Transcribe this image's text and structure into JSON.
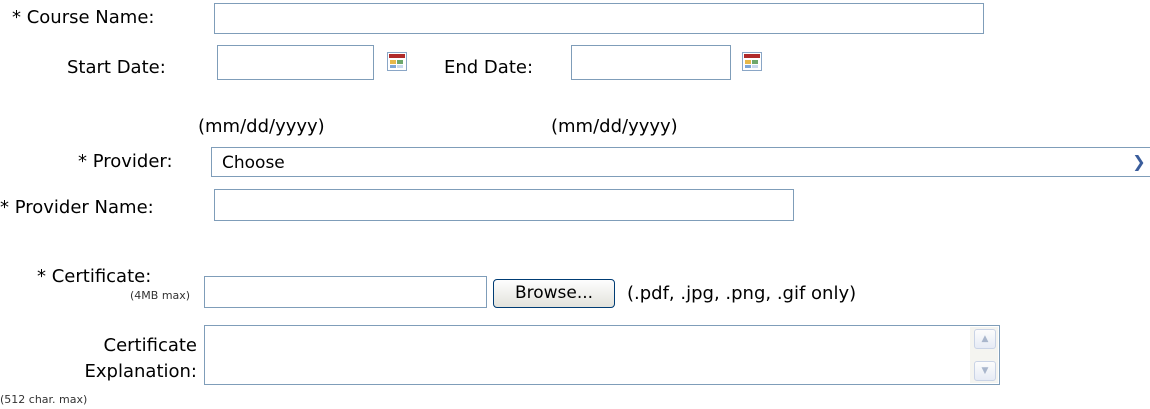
{
  "form": {
    "course_name_label": "* Course Name:",
    "course_name_value": "",
    "start_date_label": "Start Date:",
    "start_date_value": "",
    "end_date_label": "End Date:",
    "end_date_value": "",
    "date_format_hint_start": "(mm/dd/yyyy)",
    "date_format_hint_end": "(mm/dd/yyyy)",
    "provider_label": "* Provider:",
    "provider_selected": "Choose",
    "provider_name_label": "* Provider Name:",
    "provider_name_value": "",
    "certificate_label": "* Certificate:",
    "certificate_size_hint": "(4MB max)",
    "certificate_value": "",
    "browse_button_label": "Browse...",
    "certificate_types_hint": "(.pdf, .jpg, .png, .gif only)",
    "explanation_label_line1": "Certificate",
    "explanation_label_line2": "Explanation:",
    "explanation_char_hint": "(512 char. max)",
    "explanation_value": ""
  },
  "icons": {
    "calendar": "calendar-icon",
    "dropdown": "chevron-down-icon",
    "scroll_up": "scroll-up-arrow-icon",
    "scroll_down": "scroll-down-arrow-icon"
  },
  "colors": {
    "input_border": "#7f9db9",
    "button_border": "#003c74",
    "dropdown_arrow": "#3a5d9c"
  }
}
